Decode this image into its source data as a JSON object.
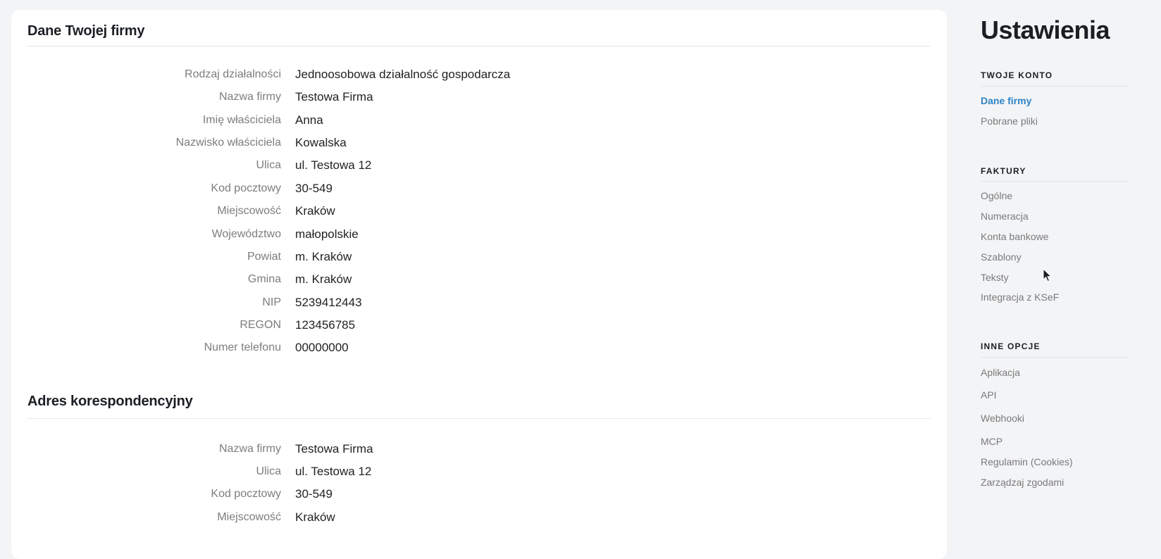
{
  "company_section": {
    "title": "Dane Twojej firmy",
    "rows": [
      {
        "label": "Rodzaj działalności",
        "value": "Jednoosobowa działalność gospodarcza"
      },
      {
        "label": "Nazwa firmy",
        "value": "Testowa Firma"
      },
      {
        "label": "Imię właściciela",
        "value": "Anna"
      },
      {
        "label": "Nazwisko właściciela",
        "value": "Kowalska"
      },
      {
        "label": "Ulica",
        "value": "ul. Testowa 12"
      },
      {
        "label": "Kod pocztowy",
        "value": "30-549"
      },
      {
        "label": "Miejscowość",
        "value": "Kraków"
      },
      {
        "label": "Województwo",
        "value": "małopolskie"
      },
      {
        "label": "Powiat",
        "value": "m. Kraków"
      },
      {
        "label": "Gmina",
        "value": "m. Kraków"
      },
      {
        "label": "NIP",
        "value": "5239412443"
      },
      {
        "label": "REGON",
        "value": "123456785"
      },
      {
        "label": "Numer telefonu",
        "value": "00000000"
      }
    ]
  },
  "correspondence_section": {
    "title": "Adres korespondencyjny",
    "rows": [
      {
        "label": "Nazwa firmy",
        "value": "Testowa Firma"
      },
      {
        "label": "Ulica",
        "value": "ul. Testowa 12"
      },
      {
        "label": "Kod pocztowy",
        "value": "30-549"
      },
      {
        "label": "Miejscowość",
        "value": "Kraków"
      }
    ]
  },
  "sidebar": {
    "title": "Ustawienia",
    "groups": [
      {
        "heading": "TWOJE KONTO",
        "items": [
          {
            "label": "Dane firmy",
            "active": true
          },
          {
            "label": "Pobrane pliki",
            "active": false
          }
        ]
      },
      {
        "heading": "FAKTURY",
        "items": [
          {
            "label": "Ogólne",
            "active": false
          },
          {
            "label": "Numeracja",
            "active": false
          },
          {
            "label": "Konta bankowe",
            "active": false
          },
          {
            "label": "Szablony",
            "active": false
          },
          {
            "label": "Teksty",
            "active": false
          },
          {
            "label": "Integracja z KSeF",
            "active": false
          }
        ]
      },
      {
        "heading": "INNE OPCJE",
        "items": [
          {
            "label": "Aplikacja",
            "active": false
          },
          {
            "label": "API",
            "active": false
          },
          {
            "label": "Webhooki",
            "active": false
          },
          {
            "label": "MCP",
            "active": false
          },
          {
            "label": "Regulamin (Cookies)",
            "active": false
          },
          {
            "label": "Zarządzaj zgodami",
            "active": false
          }
        ]
      }
    ]
  },
  "colors": {
    "active_link": "#2d83c6",
    "muted_text": "#7a7a7a",
    "background": "#f3f4f6"
  }
}
